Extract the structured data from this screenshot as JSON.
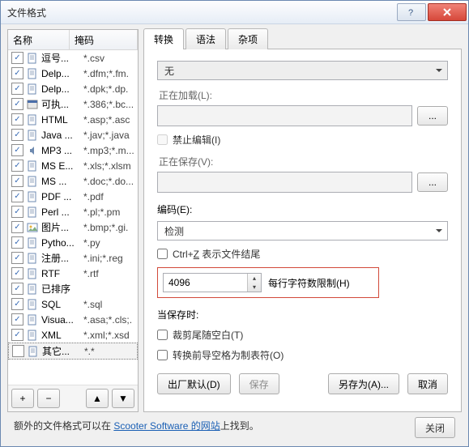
{
  "window": {
    "title": "文件格式"
  },
  "left": {
    "headers": {
      "name": "名称",
      "mask": "掩码"
    },
    "items": [
      {
        "checked": true,
        "icon": "file",
        "name": "逗号...",
        "mask": "*.csv"
      },
      {
        "checked": true,
        "icon": "file",
        "name": "Delp...",
        "mask": "*.dfm;*.fm."
      },
      {
        "checked": true,
        "icon": "file",
        "name": "Delp...",
        "mask": "*.dpk;*.dp."
      },
      {
        "checked": true,
        "icon": "exe",
        "name": "可执...",
        "mask": "*.386;*.bc..."
      },
      {
        "checked": true,
        "icon": "file",
        "name": "HTML",
        "mask": "*.asp;*.asc"
      },
      {
        "checked": true,
        "icon": "file",
        "name": "Java ...",
        "mask": "*.jav;*.java"
      },
      {
        "checked": true,
        "icon": "audio",
        "name": "MP3 ...",
        "mask": "*.mp3;*.m..."
      },
      {
        "checked": true,
        "icon": "file",
        "name": "MS E...",
        "mask": "*.xls;*.xlsm"
      },
      {
        "checked": true,
        "icon": "file",
        "name": "MS ...",
        "mask": "*.doc;*.do..."
      },
      {
        "checked": true,
        "icon": "file",
        "name": "PDF ...",
        "mask": "*.pdf"
      },
      {
        "checked": true,
        "icon": "file",
        "name": "Perl ...",
        "mask": "*.pl;*.pm"
      },
      {
        "checked": true,
        "icon": "image",
        "name": "图片...",
        "mask": "*.bmp;*.gi."
      },
      {
        "checked": true,
        "icon": "file",
        "name": "Pytho...",
        "mask": "*.py"
      },
      {
        "checked": true,
        "icon": "file",
        "name": "注册...",
        "mask": "*.ini;*.reg"
      },
      {
        "checked": true,
        "icon": "file",
        "name": "RTF",
        "mask": "*.rtf"
      },
      {
        "checked": true,
        "icon": "file",
        "name": "已排序",
        "mask": ""
      },
      {
        "checked": true,
        "icon": "file",
        "name": "SQL",
        "mask": "*.sql"
      },
      {
        "checked": true,
        "icon": "file",
        "name": "Visua...",
        "mask": "*.asa;*.cls;."
      },
      {
        "checked": true,
        "icon": "file",
        "name": "XML",
        "mask": "*.xml;*.xsd"
      },
      {
        "checked": false,
        "icon": "file",
        "name": "其它...",
        "mask": "*.*",
        "selected": true
      }
    ],
    "buttons": {
      "add": "+",
      "remove": "−"
    }
  },
  "tabs": {
    "t1": "转换",
    "t2": "语法",
    "t3": "杂项"
  },
  "panel": {
    "none_dd": "无",
    "loading_label": "正在加载(L):",
    "disable_edit_label": "禁止编辑(I)",
    "saving_label": "正在保存(V):",
    "encoding_label": "编码(E):",
    "encoding_dd": "检测",
    "ctrlz_label": "Ctrl+Z 表示文件结尾",
    "charlimit_value": "4096",
    "charlimit_label": "每行字符数限制(H)",
    "onsave_label": "当保存时:",
    "trim_label": "裁剪尾随空白(T)",
    "tabs_label": "转换前导空格为制表符(O)",
    "factory_btn": "出厂默认(D)",
    "save_btn": "保存",
    "saveas_btn": "另存为(A)...",
    "cancel_btn": "取消"
  },
  "footer": {
    "pre": "额外的文件格式可以在 ",
    "link": "Scooter Software 的网站",
    "post": "上找到。"
  },
  "close_btn": "关闭"
}
